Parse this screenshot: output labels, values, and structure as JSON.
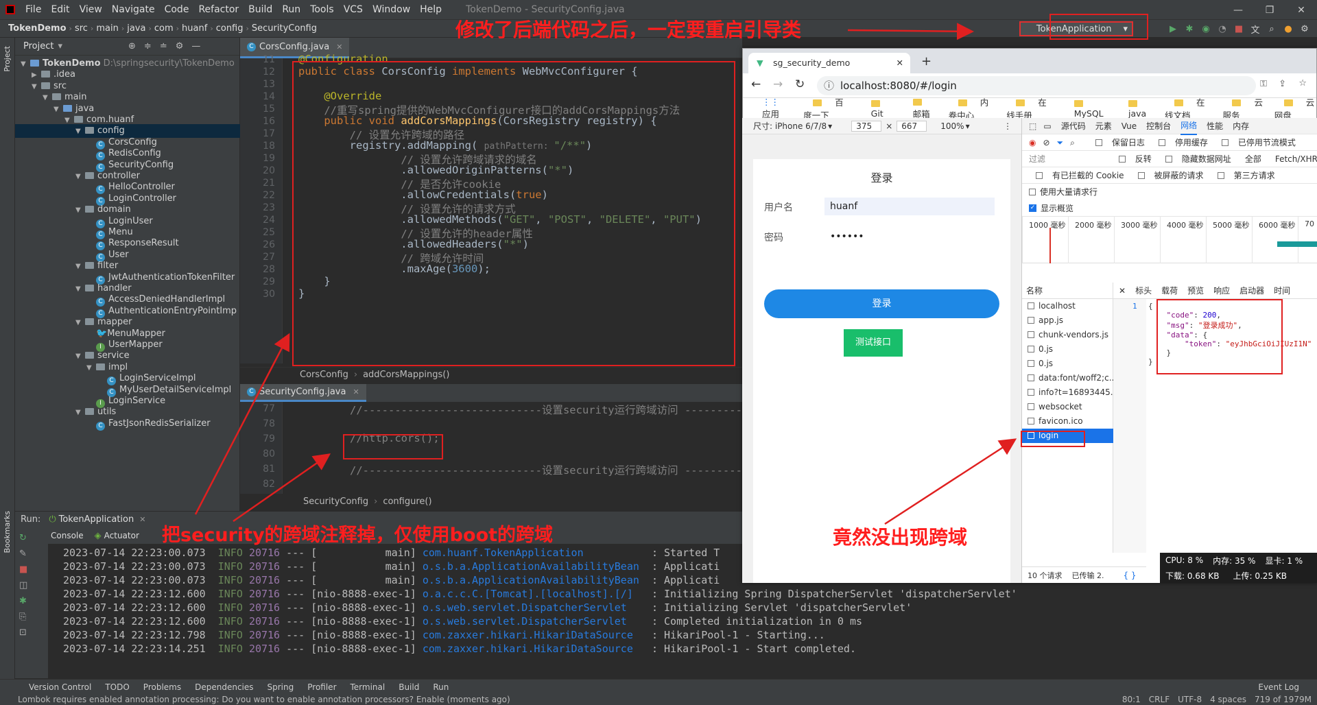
{
  "ide": {
    "menu": [
      "File",
      "Edit",
      "View",
      "Navigate",
      "Code",
      "Refactor",
      "Build",
      "Run",
      "Tools",
      "VCS",
      "Window",
      "Help"
    ],
    "window_title": "TokenDemo - SecurityConfig.java",
    "breadcrumbs": [
      "TokenDemo",
      "src",
      "main",
      "java",
      "com",
      "huanf",
      "config",
      "SecurityConfig"
    ],
    "run_config": "TokenApplication",
    "project_label": "Project",
    "project_tree": [
      {
        "label": "TokenDemo",
        "path": "D:\\springsecurity\\TokenDemo",
        "type": "folder-blue",
        "indent": 0,
        "open": true
      },
      {
        "label": ".idea",
        "type": "folder",
        "indent": 1,
        "open": false
      },
      {
        "label": "src",
        "type": "folder",
        "indent": 1,
        "open": true
      },
      {
        "label": "main",
        "type": "folder",
        "indent": 2,
        "open": true
      },
      {
        "label": "java",
        "type": "folder-blue",
        "indent": 3,
        "open": true
      },
      {
        "label": "com.huanf",
        "type": "folder",
        "indent": 4,
        "open": true
      },
      {
        "label": "config",
        "type": "folder",
        "indent": 5,
        "open": true,
        "selected": true
      },
      {
        "label": "CorsConfig",
        "type": "class",
        "indent": 6
      },
      {
        "label": "RedisConfig",
        "type": "class",
        "indent": 6
      },
      {
        "label": "SecurityConfig",
        "type": "class",
        "indent": 6
      },
      {
        "label": "controller",
        "type": "folder",
        "indent": 5,
        "open": true
      },
      {
        "label": "HelloController",
        "type": "class",
        "indent": 6
      },
      {
        "label": "LoginController",
        "type": "class",
        "indent": 6
      },
      {
        "label": "domain",
        "type": "folder",
        "indent": 5,
        "open": true
      },
      {
        "label": "LoginUser",
        "type": "class",
        "indent": 6
      },
      {
        "label": "Menu",
        "type": "class",
        "indent": 6
      },
      {
        "label": "ResponseResult",
        "type": "class",
        "indent": 6
      },
      {
        "label": "User",
        "type": "class",
        "indent": 6
      },
      {
        "label": "filter",
        "type": "folder",
        "indent": 5,
        "open": true
      },
      {
        "label": "JwtAuthenticationTokenFilter",
        "type": "class",
        "indent": 6
      },
      {
        "label": "handler",
        "type": "folder",
        "indent": 5,
        "open": true
      },
      {
        "label": "AccessDeniedHandlerImpl",
        "type": "class",
        "indent": 6
      },
      {
        "label": "AuthenticationEntryPointImp",
        "type": "class",
        "indent": 6
      },
      {
        "label": "mapper",
        "type": "folder",
        "indent": 5,
        "open": true
      },
      {
        "label": "MenuMapper",
        "type": "mapper",
        "indent": 6
      },
      {
        "label": "UserMapper",
        "type": "interface",
        "indent": 6
      },
      {
        "label": "service",
        "type": "folder",
        "indent": 5,
        "open": true
      },
      {
        "label": "impl",
        "type": "folder",
        "indent": 6,
        "open": true
      },
      {
        "label": "LoginServiceImpl",
        "type": "class",
        "indent": 7
      },
      {
        "label": "MyUserDetailServiceImpl",
        "type": "class",
        "indent": 7
      },
      {
        "label": "LoginService",
        "type": "interface",
        "indent": 6
      },
      {
        "label": "utils",
        "type": "folder",
        "indent": 5,
        "open": true
      },
      {
        "label": "FastJsonRedisSerializer",
        "type": "class",
        "indent": 6
      }
    ],
    "editor1": {
      "tab": "CorsConfig.java",
      "breadcrumb": [
        "CorsConfig",
        "addCorsMappings()"
      ],
      "lines": [
        {
          "n": "11",
          "html": "<span class='an'>@Configuration</span>"
        },
        {
          "n": "12",
          "html": "<span class='kw'>public class </span>CorsConfig <span class='kw'>implements </span>WebMvcConfigurer {"
        },
        {
          "n": "13",
          "html": ""
        },
        {
          "n": "14",
          "html": "    <span class='an'>@Override</span>"
        },
        {
          "n": "15",
          "html": "    <span class='cm'>//重写spring提供的WebMvcConfigurer接口的addCorsMappings方法</span>"
        },
        {
          "n": "16",
          "html": "    <span class='kw'>public void </span><span class='fn'>addCorsMappings</span>(CorsRegistry registry) {"
        },
        {
          "n": "17",
          "html": "        <span class='cm'>// 设置允许跨域的路径</span>"
        },
        {
          "n": "18",
          "html": "        registry.addMapping( <span class='hint'>pathPattern: </span><span class='str'>\"/**\"</span>)"
        },
        {
          "n": "19",
          "html": "                <span class='cm'>// 设置允许跨域请求的域名</span>"
        },
        {
          "n": "20",
          "html": "                .allowedOriginPatterns(<span class='str'>\"*\"</span>)"
        },
        {
          "n": "21",
          "html": "                <span class='cm'>// 是否允许cookie</span>"
        },
        {
          "n": "22",
          "html": "                .allowCredentials(<span class='kw'>true</span>)"
        },
        {
          "n": "23",
          "html": "                <span class='cm'>// 设置允许的请求方式</span>"
        },
        {
          "n": "24",
          "html": "                .allowedMethods(<span class='str'>\"GET\"</span>, <span class='str'>\"POST\"</span>, <span class='str'>\"DELETE\"</span>, <span class='str'>\"PUT\"</span>)"
        },
        {
          "n": "25",
          "html": "                <span class='cm'>// 设置允许的header属性</span>"
        },
        {
          "n": "26",
          "html": "                .allowedHeaders(<span class='str'>\"*\"</span>)"
        },
        {
          "n": "27",
          "html": "                <span class='cm'>// 跨域允许时间</span>"
        },
        {
          "n": "28",
          "html": "                .maxAge(<span class='num'>3600</span>);"
        },
        {
          "n": "29",
          "html": "    }"
        },
        {
          "n": "30",
          "html": "}"
        }
      ]
    },
    "editor2": {
      "tab": "SecurityConfig.java",
      "breadcrumb": [
        "SecurityConfig",
        "configure()"
      ],
      "lines": [
        {
          "n": "77",
          "html": "<span class='cm'>//----------------------------设置security运行跨域访问 ------------------------------</span>"
        },
        {
          "n": "78",
          "html": ""
        },
        {
          "n": "79",
          "html": "<span class='cm'>//http.cors();</span>"
        },
        {
          "n": "80",
          "html": ""
        },
        {
          "n": "81",
          "html": "<span class='cm'>//----------------------------设置security运行跨域访问 ------------------------------</span>"
        },
        {
          "n": "82",
          "html": ""
        }
      ]
    },
    "run": {
      "label": "Run:",
      "tab": "TokenApplication",
      "subtabs": [
        "Console",
        "Actuator"
      ],
      "log": [
        {
          "time": "2023-07-14 22:23:00.073",
          "lvl": "INFO",
          "pid": "20716",
          "thread": "[           main]",
          "cls": "com.huanf.TokenApplication",
          "msg": ": Started T"
        },
        {
          "time": "2023-07-14 22:23:00.073",
          "lvl": "INFO",
          "pid": "20716",
          "thread": "[           main]",
          "cls": "o.s.b.a.ApplicationAvailabilityBean",
          "msg": ": Applicati"
        },
        {
          "time": "2023-07-14 22:23:00.073",
          "lvl": "INFO",
          "pid": "20716",
          "thread": "[           main]",
          "cls": "o.s.b.a.ApplicationAvailabilityBean",
          "msg": ": Applicati"
        },
        {
          "time": "2023-07-14 22:23:12.600",
          "lvl": "INFO",
          "pid": "20716",
          "thread": "[nio-8888-exec-1]",
          "cls": "o.a.c.c.C.[Tomcat].[localhost].[/]",
          "msg": ": Initializing Spring DispatcherServlet 'dispatcherServlet'"
        },
        {
          "time": "2023-07-14 22:23:12.600",
          "lvl": "INFO",
          "pid": "20716",
          "thread": "[nio-8888-exec-1]",
          "cls": "o.s.web.servlet.DispatcherServlet",
          "msg": ": Initializing Servlet 'dispatcherServlet'"
        },
        {
          "time": "2023-07-14 22:23:12.600",
          "lvl": "INFO",
          "pid": "20716",
          "thread": "[nio-8888-exec-1]",
          "cls": "o.s.web.servlet.DispatcherServlet",
          "msg": ": Completed initialization in 0 ms"
        },
        {
          "time": "2023-07-14 22:23:12.798",
          "lvl": "INFO",
          "pid": "20716",
          "thread": "[nio-8888-exec-1]",
          "cls": "com.zaxxer.hikari.HikariDataSource",
          "msg": ": HikariPool-1 - Starting..."
        },
        {
          "time": "2023-07-14 22:23:14.251",
          "lvl": "INFO",
          "pid": "20716",
          "thread": "[nio-8888-exec-1]",
          "cls": "com.zaxxer.hikari.HikariDataSource",
          "msg": ": HikariPool-1 - Start completed."
        }
      ]
    },
    "bottom_tabs": [
      "Version Control",
      "TODO",
      "Problems",
      "Dependencies",
      "Spring",
      "Profiler",
      "Terminal",
      "Build",
      "Run"
    ],
    "event_log": "Event Log",
    "status_msg": "Lombok requires enabled annotation processing: Do you want to enable annotation processors? Enable (moments ago)",
    "status_right": [
      "80:1",
      "CRLF",
      "UTF-8",
      "4 spaces"
    ],
    "memory": "719 of 1979M"
  },
  "browser": {
    "tab_title": "sg_security_demo",
    "url": "localhost:8080/#/login",
    "bookmarks": [
      "应用",
      "百度一下",
      "Git",
      "邮箱",
      "内卷中心",
      "在线手册",
      "MySQL",
      "java",
      "在线文档",
      "云服务",
      "云网盘"
    ],
    "device": {
      "label": "尺寸: iPhone 6/7/8",
      "width": "375",
      "height": "667",
      "zoom": "100%"
    },
    "login": {
      "title": "登录",
      "user_label": "用户名",
      "user_value": "huanf",
      "pwd_label": "密码",
      "pwd_value": "••••••",
      "login_btn": "登录",
      "test_btn": "测试接口"
    },
    "devtools": {
      "tabs": [
        "源代码",
        "元素",
        "Vue",
        "控制台",
        "网络",
        "性能",
        "内存"
      ],
      "active_tab": "网络",
      "options1": [
        "保留日志",
        "停用缓存",
        "已停用节流模式"
      ],
      "filter_placeholder": "过滤",
      "options2": [
        "反转",
        "隐藏数据网址",
        "全部",
        "Fetch/XHR"
      ],
      "options3": [
        "有已拦截的 Cookie",
        "被屏蔽的请求",
        "第三方请求"
      ],
      "options4": [
        "使用大量请求行",
        "显示概览"
      ],
      "timeline": [
        "1000 毫秒",
        "2000 毫秒",
        "3000 毫秒",
        "4000 毫秒",
        "5000 毫秒",
        "6000 毫秒",
        "70"
      ],
      "name_col": "名称",
      "detail_tabs": [
        "标头",
        "载荷",
        "预览",
        "响应",
        "启动器",
        "时间"
      ],
      "requests": [
        "localhost",
        "app.js",
        "chunk-vendors.js",
        "0.js",
        "0.js",
        "data:font/woff2;c...",
        "info?t=16893445...",
        "websocket",
        "favicon.ico",
        "login"
      ],
      "selected_request": "login",
      "response": [
        "{",
        "    \"code\": 200,",
        "    \"msg\": \"登录成功\",",
        "    \"data\": {",
        "        \"token\": \"eyJhbGciOiJIUzI1N",
        "    }",
        "}"
      ],
      "footer": [
        "10 个请求",
        "已传输 2."
      ],
      "perf": {
        "cpu": "CPU: 8 %",
        "mem": "内存: 35 %",
        "gpu": "显卡: 1 %",
        "down": "下载: 0.68 KB",
        "up": "上传: 0.25 KB"
      }
    }
  },
  "annotations": {
    "top": "修改了后端代码之后，一定要重启引导类",
    "left": "把security的跨域注释掉，仅使用boot的跨域",
    "right": "竟然没出现跨域"
  },
  "colors": {
    "annotation": "#ff1e1e",
    "ide_bg": "#2b2b2b",
    "panel": "#3c3f41",
    "primary_btn": "#1e88e5",
    "test_btn": "#19be6b"
  }
}
